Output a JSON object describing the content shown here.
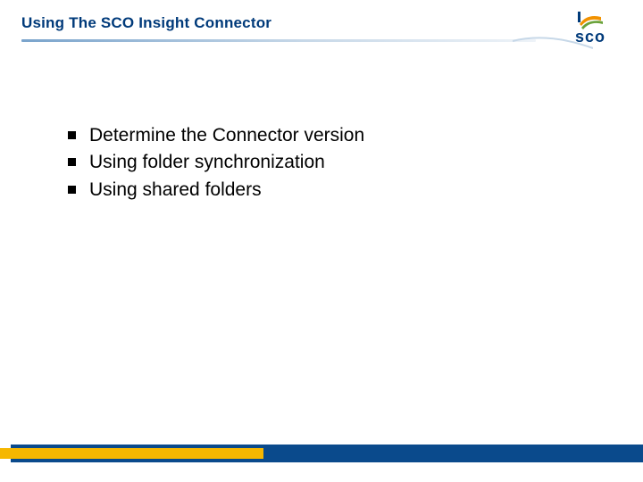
{
  "header": {
    "title": "Using The SCO Insight Connector",
    "logo_text": "sco"
  },
  "bullets": {
    "items": [
      "Determine the Connector version",
      "Using folder synchronization",
      "Using shared folders"
    ]
  },
  "colors": {
    "title": "#003a7a",
    "footer_blue": "#0a4a8c",
    "footer_yellow": "#f6b700",
    "logo_orange": "#f29200",
    "logo_green": "#6aa23a"
  }
}
